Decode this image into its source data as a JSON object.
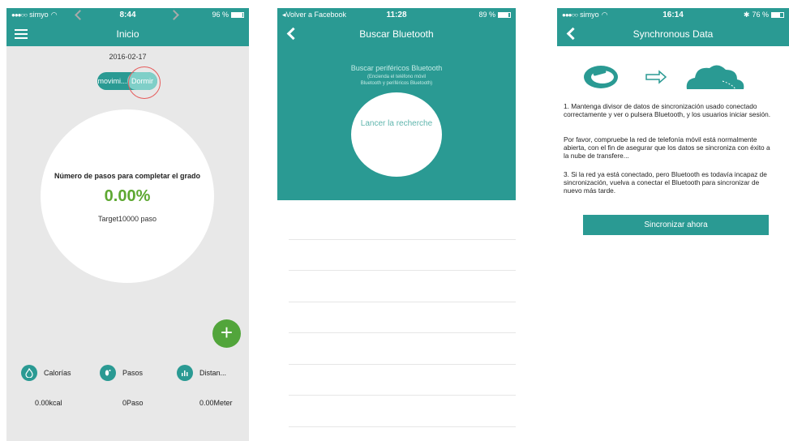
{
  "screen1": {
    "status": {
      "carrier": "simyo",
      "time": "8:44",
      "battery": "96 %"
    },
    "nav": {
      "title": "Inicio"
    },
    "date": "2016-02-17",
    "toggle": {
      "left": "movimi...",
      "right": "Dormir"
    },
    "progress": {
      "label": "Número de pasos para completar el grado",
      "percent": "0.00%",
      "target": "Target10000 paso"
    },
    "fab_label": "+",
    "stats": [
      {
        "label": "Calorías",
        "icon": "flame-icon",
        "value": "0.00kcal"
      },
      {
        "label": "Pasos",
        "icon": "footprint-icon",
        "value": "0Paso"
      },
      {
        "label": "Distan...",
        "icon": "bar-chart-icon",
        "value": "0.00Meter"
      }
    ]
  },
  "screen2": {
    "status": {
      "back_app": "◂Volver a Facebook",
      "time": "11:28",
      "battery": "89 %"
    },
    "nav": {
      "title": "Buscar Bluetooth"
    },
    "scan_title": "Buscar periféricos Bluetooth",
    "scan_sub_1": "(Encienda el teléfono móvil",
    "scan_sub_2": "Bluetooth y periféricos Bluetooth)",
    "scan_button": "Lancer la recherche"
  },
  "screen3": {
    "status": {
      "carrier": "simyo",
      "time": "16:14",
      "battery": "76 %"
    },
    "nav": {
      "title": "Synchronous Data"
    },
    "para1": "1. Mantenga divisor de datos de sincronización usado conectado correctamente y ver o pulsera Bluetooth, y los usuarios iniciar sesión.",
    "para2": "Por favor, compruebe la red de telefonía móvil está normalmente abierta, con el fin de asegurar que los datos se sincroniza con éxito a la nube de transfere...",
    "para3": "3. Si la red ya está conectado, pero Bluetooth es todavía incapaz de sincronización, vuelva a conectar el Bluetooth para sincronizar de nuevo más tarde.",
    "sync_button": "Sincronizar ahora"
  },
  "colors": {
    "accent": "#2a9a93",
    "green": "#5ea832",
    "fab": "#52a53b"
  }
}
